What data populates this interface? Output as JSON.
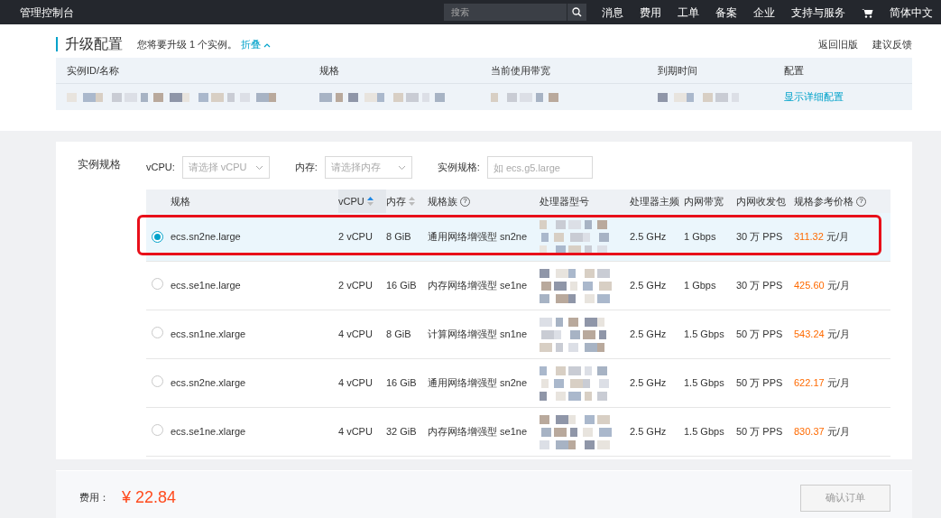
{
  "topbar": {
    "title": "管理控制台",
    "search": {
      "placeholder": "搜索"
    },
    "nav": [
      "消息",
      "费用",
      "工单",
      "备案",
      "企业",
      "支持与服务"
    ],
    "language": "简体中文"
  },
  "upgrade": {
    "title": "升级配置",
    "note": "您将要升级 1 个实例。",
    "collapse": "折叠",
    "links": [
      "返回旧版",
      "建议反馈"
    ],
    "columns": [
      "实例ID/名称",
      "规格",
      "当前使用带宽",
      "到期时间",
      "配置"
    ],
    "detail_link": "显示详细配置"
  },
  "spec": {
    "label": "实例规格",
    "filters": [
      {
        "kind": "select",
        "label": "vCPU:",
        "placeholder": "请选择 vCPU"
      },
      {
        "kind": "select",
        "label": "内存:",
        "placeholder": "请选择内存"
      },
      {
        "kind": "input",
        "label": "实例规格:",
        "placeholder": "如 ecs.g5.large"
      }
    ],
    "columns": [
      {
        "label": "规格"
      },
      {
        "label": "vCPU",
        "sortable": true,
        "sorted": true
      },
      {
        "label": "内存",
        "sortable": true,
        "sorted": false
      },
      {
        "label": "规格族",
        "help": "?"
      },
      {
        "label": "处理器型号"
      },
      {
        "label": "处理器主频"
      },
      {
        "label": "内网带宽"
      },
      {
        "label": "内网收发包"
      },
      {
        "label": "规格参考价格",
        "help": "?"
      }
    ],
    "rows": [
      {
        "selected": true,
        "outlined": true,
        "name": "ecs.sn2ne.large",
        "vcpu": "2 vCPU",
        "memory": "8 GiB",
        "family": "通用网络增强型 sn2ne",
        "frequency": "2.5 GHz",
        "bandwidth": "1 Gbps",
        "pps": "30 万 PPS",
        "price": "311.32",
        "unit": "元/月"
      },
      {
        "selected": false,
        "outlined": false,
        "name": "ecs.se1ne.large",
        "vcpu": "2 vCPU",
        "memory": "16 GiB",
        "family": "内存网络增强型 se1ne",
        "frequency": "2.5 GHz",
        "bandwidth": "1 Gbps",
        "pps": "30 万 PPS",
        "price": "425.60",
        "unit": "元/月"
      },
      {
        "selected": false,
        "outlined": false,
        "name": "ecs.sn1ne.xlarge",
        "vcpu": "4 vCPU",
        "memory": "8 GiB",
        "family": "计算网络增强型 sn1ne",
        "frequency": "2.5 GHz",
        "bandwidth": "1.5 Gbps",
        "pps": "50 万 PPS",
        "price": "543.24",
        "unit": "元/月"
      },
      {
        "selected": false,
        "outlined": false,
        "name": "ecs.sn2ne.xlarge",
        "vcpu": "4 vCPU",
        "memory": "16 GiB",
        "family": "通用网络增强型 sn2ne",
        "frequency": "2.5 GHz",
        "bandwidth": "1.5 Gbps",
        "pps": "50 万 PPS",
        "price": "622.17",
        "unit": "元/月"
      },
      {
        "selected": false,
        "outlined": false,
        "name": "ecs.se1ne.xlarge",
        "vcpu": "4 vCPU",
        "memory": "32 GiB",
        "family": "内存网络增强型 se1ne",
        "frequency": "2.5 GHz",
        "bandwidth": "1.5 Gbps",
        "pps": "50 万 PPS",
        "price": "830.37",
        "unit": "元/月"
      }
    ]
  },
  "footer": {
    "label": "费用：",
    "amount": "¥ 22.84",
    "confirm": {
      "label": "确认订单",
      "disabled": true
    }
  }
}
